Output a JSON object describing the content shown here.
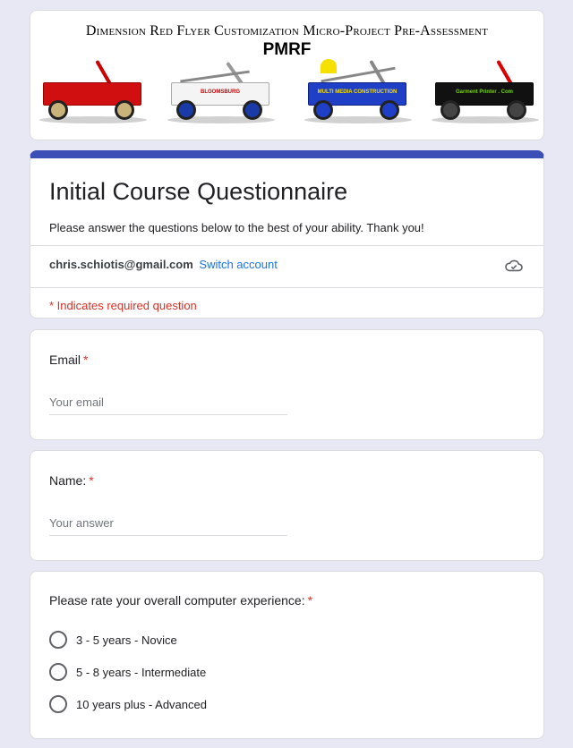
{
  "banner": {
    "title": "Dimension Red Flyer Customization Micro-Project Pre-Assessment",
    "subtitle": "PMRF",
    "wagon_labels": [
      "",
      "BLOOMSBURG",
      "MULTI MEDIA CONSTRUCTION",
      "Garment Printer . Com"
    ]
  },
  "header": {
    "title": "Initial Course Questionnaire",
    "description": "Please answer the questions below to the best of your ability. Thank you!",
    "account_email": "chris.schiotis@gmail.com",
    "switch_account": "Switch account",
    "required_note": "* Indicates required question"
  },
  "questions": {
    "email": {
      "label": "Email",
      "required_mark": "*",
      "placeholder": "Your email"
    },
    "name": {
      "label": "Name:",
      "required_mark": "*",
      "placeholder": "Your answer"
    },
    "experience": {
      "label": "Please rate your overall computer experience:",
      "required_mark": "*",
      "options": [
        "3 - 5 years - Novice",
        "5 - 8 years - Intermediate",
        "10 years plus - Advanced"
      ]
    }
  },
  "colors": {
    "accent": "#3c4fb6",
    "required": "#d93025",
    "link": "#1a73e8",
    "background": "#e8e8f4"
  },
  "icons": {
    "cloud": "cloud-check-icon"
  }
}
